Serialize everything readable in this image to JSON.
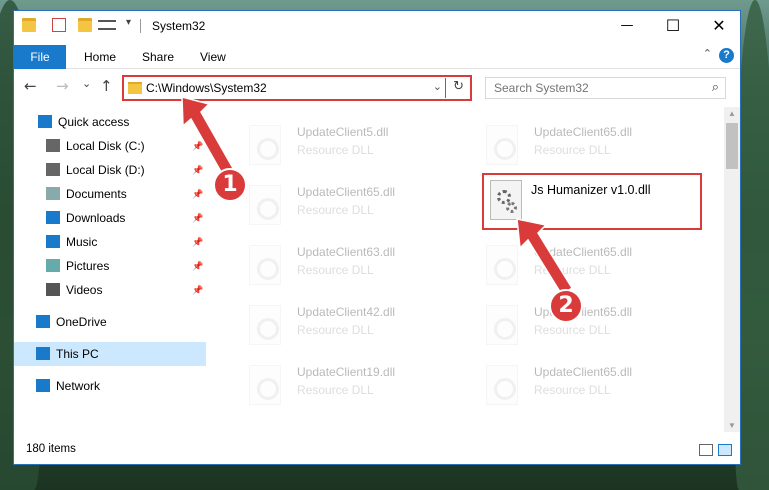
{
  "window": {
    "title": "System32"
  },
  "window_controls": {
    "minimize": "—",
    "maximize": "☐",
    "close": "✕"
  },
  "ribbon": {
    "tabs": [
      "File",
      "Home",
      "Share",
      "View"
    ],
    "collapse": "⌃",
    "help": "?"
  },
  "nav": {
    "back": "←",
    "forward": "→",
    "recent": "⌄",
    "up": "↑"
  },
  "address": {
    "path": "C:\\Windows\\System32",
    "dropdown": "⌄",
    "refresh": "↻"
  },
  "search": {
    "placeholder": "Search System32",
    "icon": "⌕"
  },
  "sidebar": {
    "items": [
      {
        "label": "Quick access",
        "icon": "star-icon",
        "pinned": false
      },
      {
        "label": "Local Disk (C:)",
        "icon": "drive-icon",
        "pinned": true
      },
      {
        "label": "Local Disk (D:)",
        "icon": "drive-icon",
        "pinned": true
      },
      {
        "label": "Documents",
        "icon": "documents-icon",
        "pinned": true
      },
      {
        "label": "Downloads",
        "icon": "download-icon",
        "pinned": true
      },
      {
        "label": "Music",
        "icon": "music-icon",
        "pinned": true
      },
      {
        "label": "Pictures",
        "icon": "pictures-icon",
        "pinned": true
      },
      {
        "label": "Videos",
        "icon": "videos-icon",
        "pinned": true
      },
      {
        "label": "OneDrive",
        "icon": "cloud-icon",
        "pinned": false
      },
      {
        "label": "This PC",
        "icon": "computer-icon",
        "pinned": false,
        "selected": true
      },
      {
        "label": "Network",
        "icon": "network-icon",
        "pinned": false
      }
    ],
    "pin_glyph": "📌"
  },
  "files": {
    "left": [
      {
        "name": "UpdateClient5.dll",
        "type": "Resource DLL"
      },
      {
        "name": "UpdateClient65.dll",
        "type": "Resource DLL"
      },
      {
        "name": "UpdateClient63.dll",
        "type": "Resource DLL"
      },
      {
        "name": "UpdateClient42.dll",
        "type": "Resource DLL"
      },
      {
        "name": "UpdateClient19.dll",
        "type": "Resource DLL"
      }
    ],
    "right": [
      {
        "name": "UpdateClient65.dll",
        "type": "Resource DLL"
      },
      {
        "name": "UpdateClient65.dll",
        "type": "Resource DLL"
      },
      {
        "name": "UpdateClient65.dll",
        "type": "Resource DLL"
      },
      {
        "name": "UpdateClient65.dll",
        "type": "Resource DLL"
      }
    ],
    "highlighted": {
      "name": "Js Humanizer v1.0.dll"
    }
  },
  "status": {
    "count": "180 items"
  },
  "callouts": {
    "one": "1",
    "two": "2"
  },
  "colors": {
    "accent": "#1979ca",
    "annotation": "#d93a3a",
    "selection": "#cce8ff"
  }
}
